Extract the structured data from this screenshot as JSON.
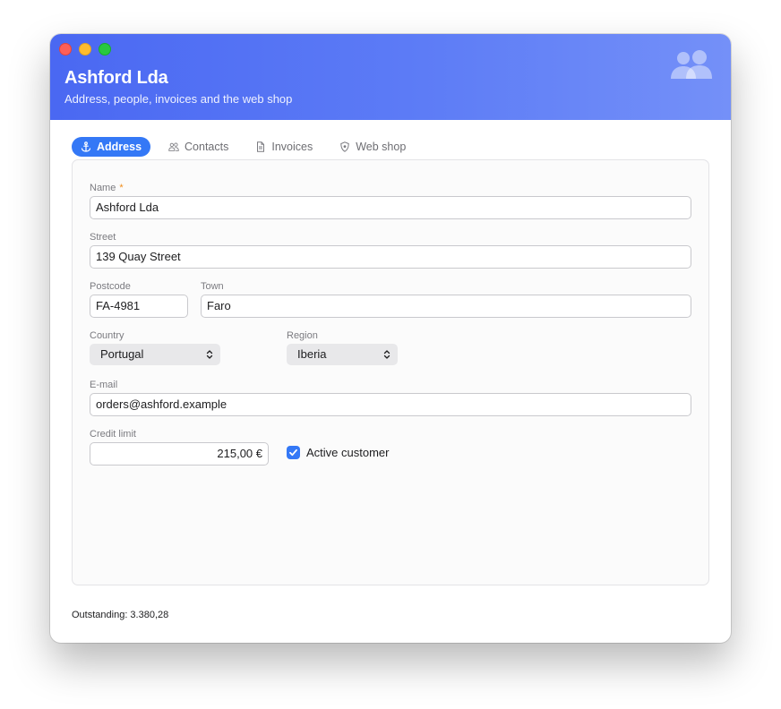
{
  "window": {
    "title": "Ashford Lda",
    "subtitle": "Address, people, invoices and the web shop",
    "header_icon": "people-icon"
  },
  "tabs": [
    {
      "label": "Address",
      "icon": "anchor-icon",
      "active": true
    },
    {
      "label": "Contacts",
      "icon": "people-icon",
      "active": false
    },
    {
      "label": "Invoices",
      "icon": "document-icon",
      "active": false
    },
    {
      "label": "Web shop",
      "icon": "shield-icon",
      "active": false
    }
  ],
  "form": {
    "name": {
      "label": "Name",
      "required_mark": "*",
      "value": "Ashford Lda"
    },
    "street": {
      "label": "Street",
      "value": "139 Quay Street"
    },
    "postcode": {
      "label": "Postcode",
      "value": "FA-4981"
    },
    "town": {
      "label": "Town",
      "value": "Faro"
    },
    "country": {
      "label": "Country",
      "value": "Portugal"
    },
    "region": {
      "label": "Region",
      "value": "Iberia"
    },
    "email": {
      "label": "E-mail",
      "value": "orders@ashford.example"
    },
    "credit_limit": {
      "label": "Credit limit",
      "value": "215,00 €"
    },
    "active_customer": {
      "label": "Active customer",
      "checked": true
    }
  },
  "footer": {
    "outstanding": "Outstanding: 3.380,28"
  },
  "colors": {
    "accent": "#3478f6",
    "header_start": "#4a68f2",
    "header_end": "#7490f8",
    "required": "#f08c18"
  }
}
